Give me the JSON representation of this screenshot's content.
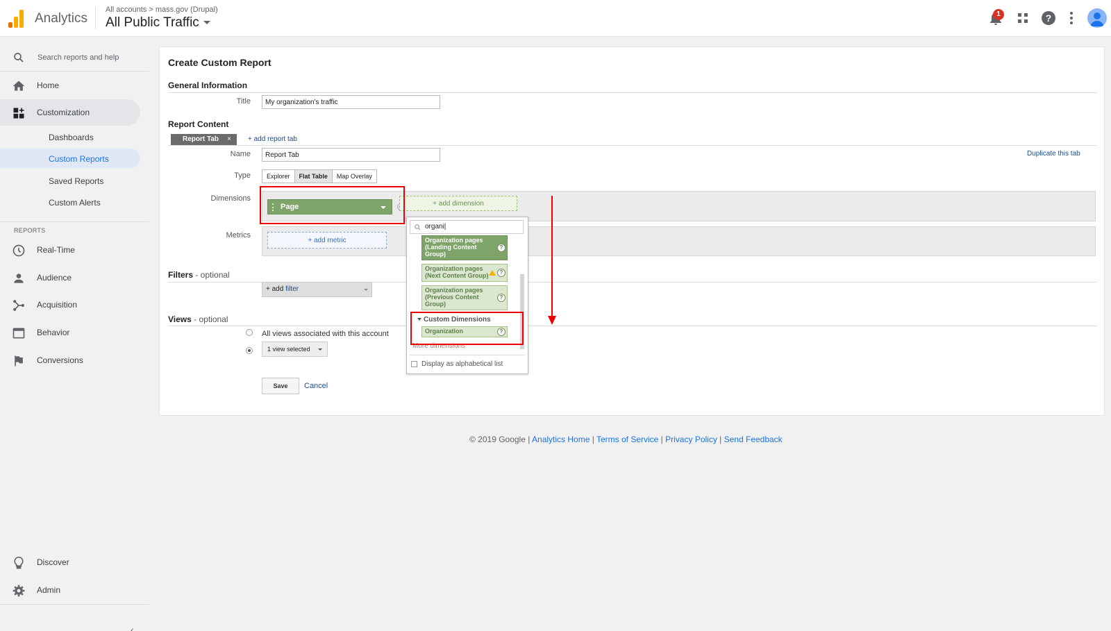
{
  "header": {
    "app_name": "Analytics",
    "breadcrumb": "All accounts > mass.gov (Drupal)",
    "view_name": "All Public Traffic",
    "notification_count": "1"
  },
  "sidebar": {
    "search_label": "Search reports and help",
    "home": "Home",
    "customization": "Customization",
    "sub_items": [
      "Dashboards",
      "Custom Reports",
      "Saved Reports",
      "Custom Alerts"
    ],
    "reports_section": "REPORTS",
    "reports": [
      "Real-Time",
      "Audience",
      "Acquisition",
      "Behavior",
      "Conversions"
    ],
    "discover": "Discover",
    "admin": "Admin"
  },
  "form": {
    "page_title": "Create Custom Report",
    "general_heading": "General Information",
    "title_label": "Title",
    "title_value": "My organization's traffic",
    "content_heading": "Report Content",
    "tab_chip": "Report Tab",
    "tab_close": "×",
    "add_report_tab": "+ add report tab",
    "name_label": "Name",
    "name_value": "Report Tab",
    "duplicate_tab": "Duplicate this tab",
    "type_label": "Type",
    "type_options": [
      "Explorer",
      "Flat Table",
      "Map Overlay"
    ],
    "dimensions_label": "Dimensions",
    "dimension_chip": "Page",
    "add_dimension": "+ add dimension",
    "metrics_label": "Metrics",
    "add_metric": "+ add metric",
    "filters_heading": "Filters",
    "optional": " - optional",
    "add_filter_prefix": "+ add ",
    "add_filter_kw": "filter",
    "views_heading": "Views",
    "views_all": "All views associated with this account",
    "views_selected": "1 view selected",
    "save": "Save",
    "cancel": "Cancel"
  },
  "dropdown": {
    "search_value": "organi|",
    "items": [
      "Organization pages (Landing Content Group)",
      "Organization pages (Next Content Group)",
      "Organization pages (Previous Content Group)"
    ],
    "custom_heading": "Custom Dimensions",
    "custom_item": "Organization",
    "more_dimensions": "More dimensions",
    "alpha_label": "Display as alphabetical list",
    "help_glyph": "?"
  },
  "footer": {
    "copyright": "© 2019 Google | ",
    "links": [
      "Analytics Home",
      "Terms of Service",
      "Privacy Policy",
      "Send Feedback"
    ],
    "sep": " | "
  },
  "colors": {
    "accent": "#1a73e8",
    "dimension_green": "#7fa46a",
    "highlight_red": "#ee0000",
    "logo_orange": "#f9ab00",
    "logo_dark": "#e37400"
  }
}
